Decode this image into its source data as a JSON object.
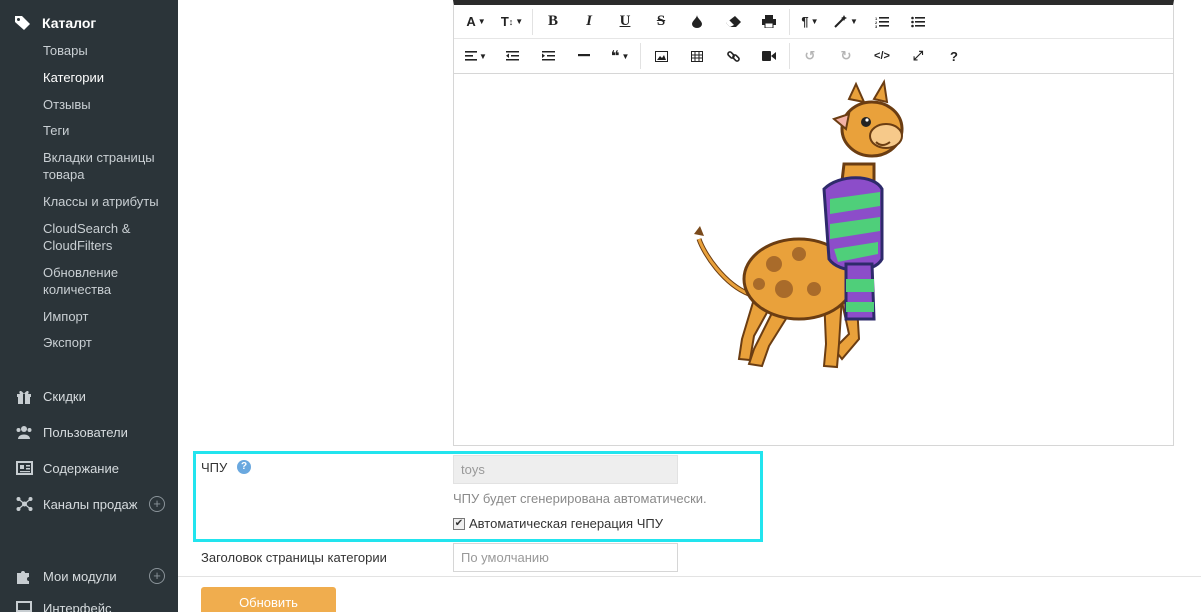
{
  "sidebar": {
    "catalog_label": "Каталог",
    "sub_items": [
      {
        "label": "Товары"
      },
      {
        "label": "Категории"
      },
      {
        "label": "Отзывы"
      },
      {
        "label": "Теги"
      },
      {
        "label": "Вкладки страницы товара"
      },
      {
        "label": "Классы и атрибуты"
      },
      {
        "label": "CloudSearch & CloudFilters"
      },
      {
        "label": "Обновление количества"
      },
      {
        "label": "Импорт"
      },
      {
        "label": "Экспорт"
      }
    ],
    "active_item": "Категории",
    "main_items": [
      {
        "label": "Скидки",
        "icon": "gift-icon"
      },
      {
        "label": "Пользователи",
        "icon": "users-icon"
      },
      {
        "label": "Содержание",
        "icon": "newspaper-icon"
      },
      {
        "label": "Каналы продаж",
        "icon": "network-icon",
        "plus": "+"
      },
      {
        "label": "Мои модули",
        "icon": "puzzle-icon",
        "plus": "+"
      },
      {
        "label": "Интерфейс",
        "icon": "monitor-icon"
      }
    ]
  },
  "editor": {
    "toolbar_row1": [
      "font-color-icon",
      "font-size-icon",
      "bold-icon",
      "italic-icon",
      "underline-icon",
      "strikethrough-icon",
      "color-drop-icon",
      "eraser-icon",
      "print-icon",
      "paragraph-icon",
      "magic-wand-icon",
      "ordered-list-icon",
      "unordered-list-icon"
    ],
    "toolbar_row2": [
      "align-icon",
      "outdent-icon",
      "indent-icon",
      "horizontal-rule-icon",
      "quote-icon",
      "image-icon",
      "table-icon",
      "link-icon",
      "video-icon",
      "undo-icon",
      "redo-icon",
      "code-view-icon",
      "fullscreen-icon",
      "help-icon"
    ],
    "content_image": "giraffe-with-scarf-image"
  },
  "form": {
    "slug_label": "ЧПУ",
    "slug_value": "toys",
    "slug_hint": "ЧПУ будет сгенерирована автоматически.",
    "auto_slug_label": "Автоматическая генерация ЧПУ",
    "auto_slug_checked": true,
    "page_title_label": "Заголовок страницы категории",
    "page_title_placeholder": "По умолчанию",
    "update_button": "Обновить"
  },
  "colors": {
    "sidebar_bg": "#2b3439",
    "highlight": "#22e4ee",
    "update_button": "#f0ad4e",
    "help_icon": "#6aa8df"
  }
}
